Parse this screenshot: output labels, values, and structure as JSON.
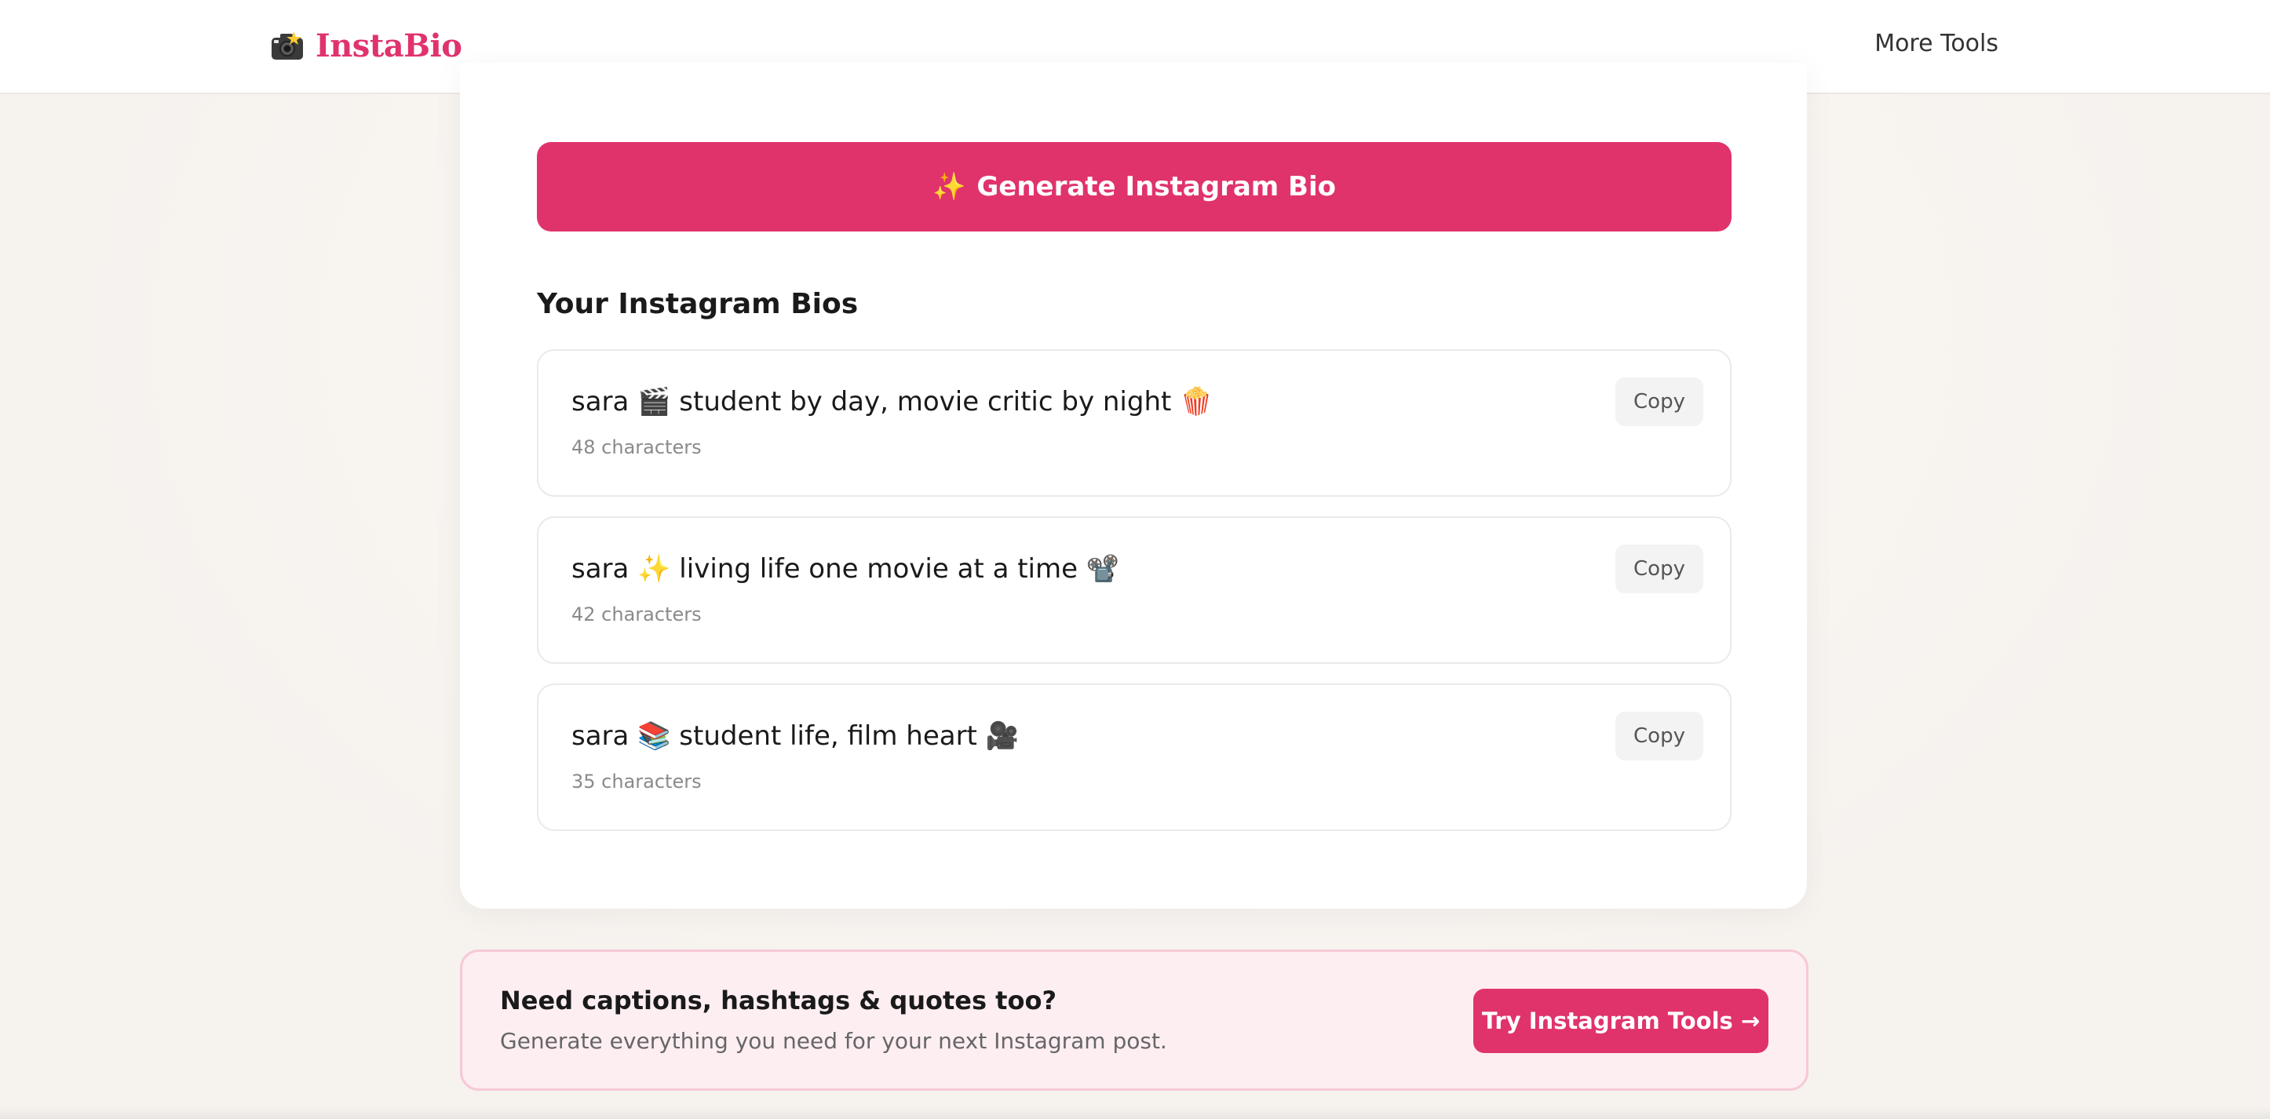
{
  "header": {
    "logo_text": "InstaBio",
    "logo_icon": "camera-flash-icon",
    "nav_more_tools": "More Tools"
  },
  "generate": {
    "icon": "sparkles-icon",
    "sparkle": "✨",
    "label": "Generate Instagram Bio"
  },
  "results": {
    "title": "Your Instagram Bios",
    "bios": [
      {
        "text": "sara 🎬 student by day, movie critic by night 🍿",
        "count": "48 characters",
        "copy_label": "Copy"
      },
      {
        "text": "sara ✨ living life one movie at a time 📽️",
        "count": "42 characters",
        "copy_label": "Copy"
      },
      {
        "text": "sara 📚 student life, film heart 🎥",
        "count": "35 characters",
        "copy_label": "Copy"
      }
    ]
  },
  "cta": {
    "title": "Need captions, hashtags & quotes too?",
    "subtitle": "Generate everything you need for your next Instagram post.",
    "button_label": "Try Instagram Tools →"
  },
  "colors": {
    "brand": "#e0336c",
    "cta_background": "#fdeef2",
    "cta_border": "#f7c8d6"
  }
}
